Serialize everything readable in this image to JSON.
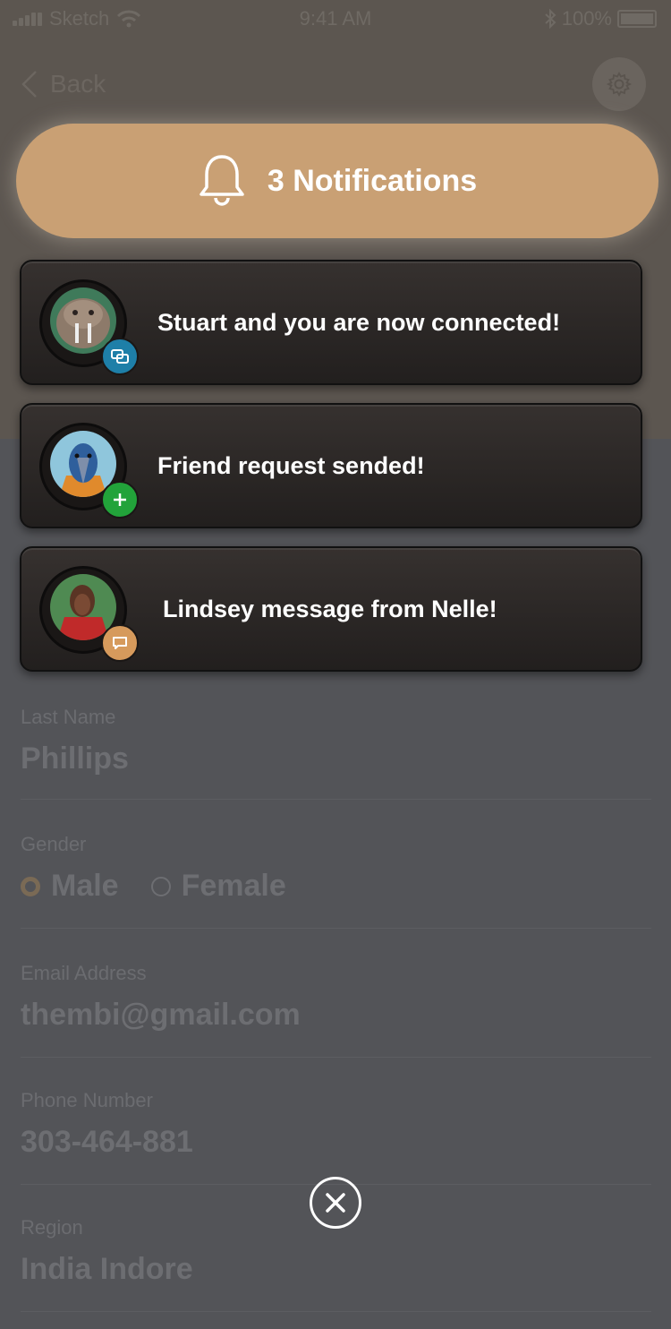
{
  "status_bar": {
    "carrier": "Sketch",
    "time": "9:41 AM",
    "battery": "100%"
  },
  "nav": {
    "back_label": "Back"
  },
  "form": {
    "last_name": {
      "label": "Last Name",
      "value": "Phillips"
    },
    "gender": {
      "label": "Gender",
      "options": [
        "Male",
        "Female"
      ],
      "selected": "Male"
    },
    "email": {
      "label": "Email Address",
      "value": "thembi@gmail.com"
    },
    "phone": {
      "label": "Phone Number",
      "value": "303-464-881"
    },
    "region": {
      "label": "Region",
      "value": "India Indore"
    }
  },
  "notifications": {
    "header": "3 Notifications",
    "items": [
      {
        "text": "Stuart and you are now connected!",
        "badge_icon": "connect-icon",
        "badge_color": "#1e7fa8"
      },
      {
        "text": "Friend request sended!",
        "badge_icon": "plus-icon",
        "badge_color": "#22a33a"
      },
      {
        "text": "Lindsey message from Nelle!",
        "badge_icon": "chat-icon",
        "badge_color": "#d69a5c"
      }
    ]
  },
  "colors": {
    "accent": "#c9a074",
    "card_bg": "#2c2826"
  }
}
